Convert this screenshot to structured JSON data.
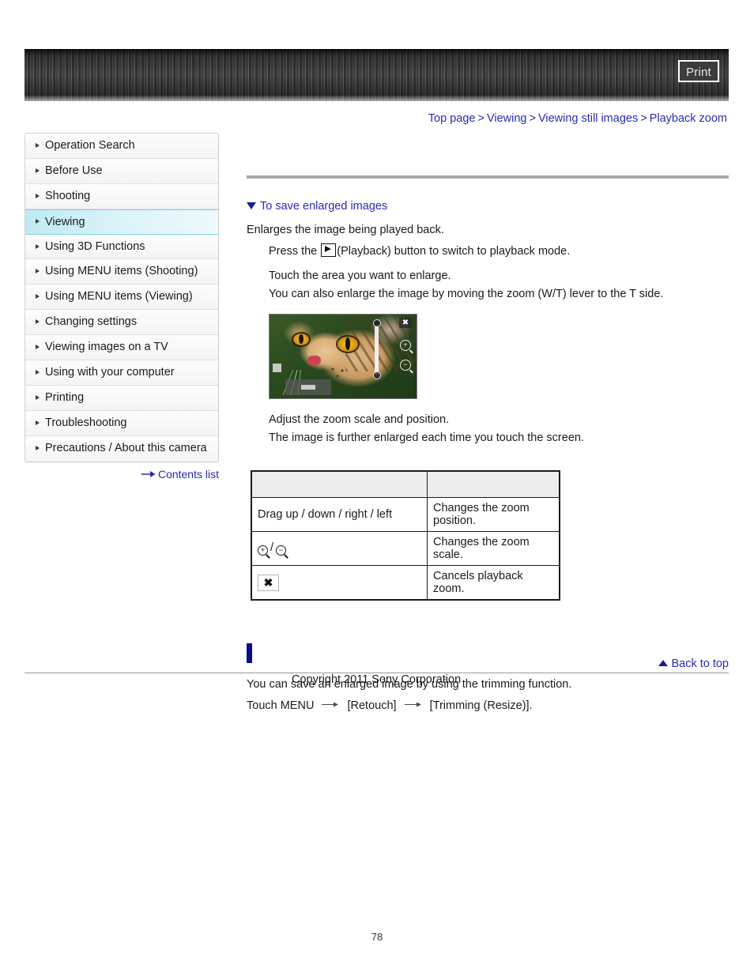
{
  "header": {
    "print_label": "Print"
  },
  "breadcrumb": {
    "items": [
      "Top page",
      "Viewing",
      "Viewing still images",
      "Playback zoom"
    ],
    "separator": ">"
  },
  "sidebar": {
    "items": [
      {
        "label": "Operation Search",
        "active": false
      },
      {
        "label": "Before Use",
        "active": false
      },
      {
        "label": "Shooting",
        "active": false
      },
      {
        "label": "Viewing",
        "active": true
      },
      {
        "label": "Using 3D Functions",
        "active": false
      },
      {
        "label": "Using MENU items (Shooting)",
        "active": false
      },
      {
        "label": "Using MENU items (Viewing)",
        "active": false
      },
      {
        "label": "Changing settings",
        "active": false
      },
      {
        "label": "Viewing images on a TV",
        "active": false
      },
      {
        "label": "Using with your computer",
        "active": false
      },
      {
        "label": "Printing",
        "active": false
      },
      {
        "label": "Troubleshooting",
        "active": false
      },
      {
        "label": "Precautions / About this camera",
        "active": false
      }
    ],
    "contents_link": "Contents list"
  },
  "main": {
    "page_title": "",
    "anchor_link": "To save enlarged images",
    "intro": "Enlarges the image being played back.",
    "step1_pre": "Press the",
    "step1_post": "(Playback) button to switch to playback mode.",
    "step2_line1": "Touch the area you want to enlarge.",
    "step2_line2": "You can also enlarge the image by moving the zoom (W/T) lever to the T side.",
    "step3_line1": "Adjust the zoom scale and position.",
    "step3_line2": "The image is further enlarged each time you touch the screen.",
    "table": {
      "headers": [
        "",
        ""
      ],
      "rows": [
        {
          "operation": "Drag up / down / right / left",
          "description": "Changes the zoom position."
        },
        {
          "operation": "",
          "operation_icons": "zoom-in / zoom-out",
          "description": "Changes the zoom scale."
        },
        {
          "operation": "",
          "operation_icons": "close",
          "description": "Cancels playback zoom."
        }
      ]
    },
    "section_heading": "",
    "section_line1": "You can save an enlarged image by using the trimming function.",
    "section_line2_pre": "Touch MENU",
    "section_line2_mid": "[Retouch]",
    "section_line2_post": "[Trimming (Resize)]."
  },
  "footer": {
    "back_to_top": "Back to top",
    "copyright": "Copyright 2011 Sony Corporation",
    "page_number": "78"
  },
  "icons": {
    "play": "play-icon",
    "zoom_in": "zoom-in-icon",
    "zoom_out": "zoom-out-icon",
    "close": "close-icon",
    "contents_arrow": "arrow-right-icon",
    "back_to_top_arrow": "triangle-up-icon",
    "anchor_arrow": "triangle-down-icon"
  },
  "colors": {
    "link": "#2b2bb0",
    "active_nav": "#bfeaf3",
    "marker": "#0a0a8c",
    "rule": "#a8a8a8"
  }
}
